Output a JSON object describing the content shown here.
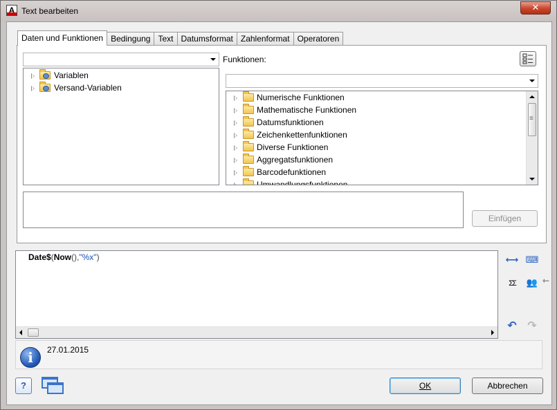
{
  "window": {
    "title": "Text bearbeiten",
    "close_glyph": "✕"
  },
  "tabs": [
    {
      "label": "Daten und Funktionen",
      "active": true
    },
    {
      "label": "Bedingung"
    },
    {
      "label": "Text"
    },
    {
      "label": "Datumsformat"
    },
    {
      "label": "Zahlenformat"
    },
    {
      "label": "Operatoren"
    }
  ],
  "variables": {
    "selected": "",
    "items": [
      {
        "label": "Variablen",
        "icon": "variable-folder-icon"
      },
      {
        "label": "Versand-Variablen",
        "icon": "shipping-variable-folder-icon"
      }
    ]
  },
  "functions": {
    "label": "Funktionen:",
    "selected": "",
    "items": [
      "Numerische Funktionen",
      "Mathematische Funktionen",
      "Datumsfunktionen",
      "Zeichenkettenfunktionen",
      "Diverse Funktionen",
      "Aggregatsfunktionen",
      "Barcodefunktionen",
      "Umwandlungsfunktionen"
    ]
  },
  "description": "",
  "insert_button": "Einfügen",
  "editor": {
    "fn1": "Date$",
    "open1": "(",
    "fn2": "Now",
    "args2": "()",
    "comma": ",",
    "str": "\"%x\"",
    "close1": ")"
  },
  "result": {
    "value": "27.01.2015"
  },
  "buttons": {
    "ok": "OK",
    "cancel": "Abbrechen",
    "help": "?"
  },
  "toolbar_icons": {
    "expand": "⟷",
    "keyboard": "⌨",
    "sum": "ΣΣ",
    "users": "👥",
    "undo": "↶",
    "redo": "↷"
  },
  "side_arrow": "⇽"
}
